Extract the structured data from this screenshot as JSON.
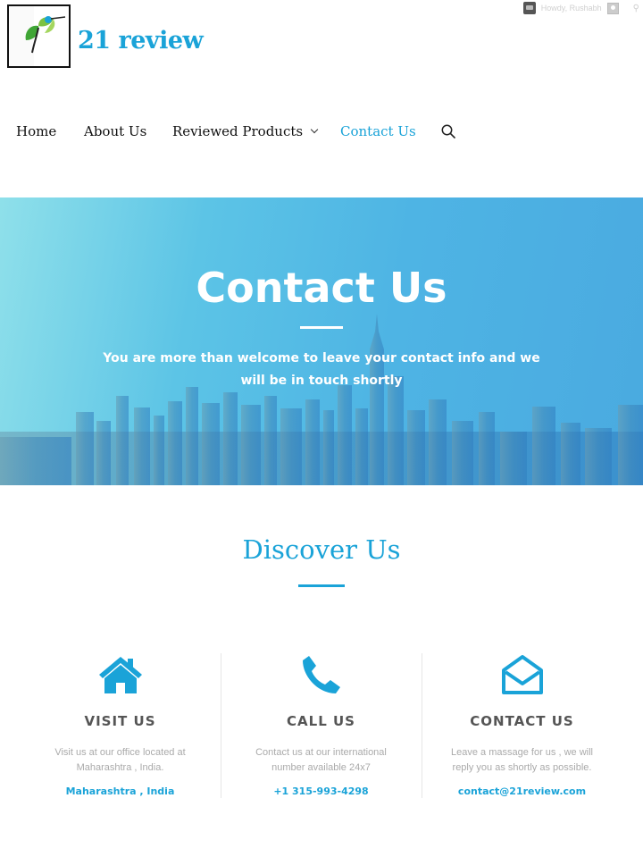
{
  "admin_bar": {
    "howdy": "Howdy, Rushabh"
  },
  "site": {
    "title": "21 review"
  },
  "nav": {
    "items": [
      "Home",
      "About Us",
      "Reviewed Products",
      "Contact Us"
    ]
  },
  "hero": {
    "title": "Contact Us",
    "subtitle_line1": "You are more than welcome to leave your contact info and we",
    "subtitle_line2": "will be in touch shortly"
  },
  "discover": {
    "title": "Discover Us",
    "columns": [
      {
        "icon": "home-icon",
        "title": "VISIT US",
        "text_line1": "Visit us at our office located at",
        "text_line2": "Maharashtra , India.",
        "link": "Maharashtra , India"
      },
      {
        "icon": "phone-icon",
        "title": "CALL US",
        "text_line1": "Contact us at our international",
        "text_line2": "number available 24x7",
        "link": "+1 315-993-4298"
      },
      {
        "icon": "envelope-open-icon",
        "title": "CONTACT US",
        "text_line1": "Leave a massage for us , we will",
        "text_line2": "reply you as shortly as possible.",
        "link": "contact@21review.com"
      }
    ]
  },
  "colors": {
    "accent": "#1aa3d8",
    "hero_start": "#8fe0ea",
    "hero_end": "#4aaae0"
  }
}
